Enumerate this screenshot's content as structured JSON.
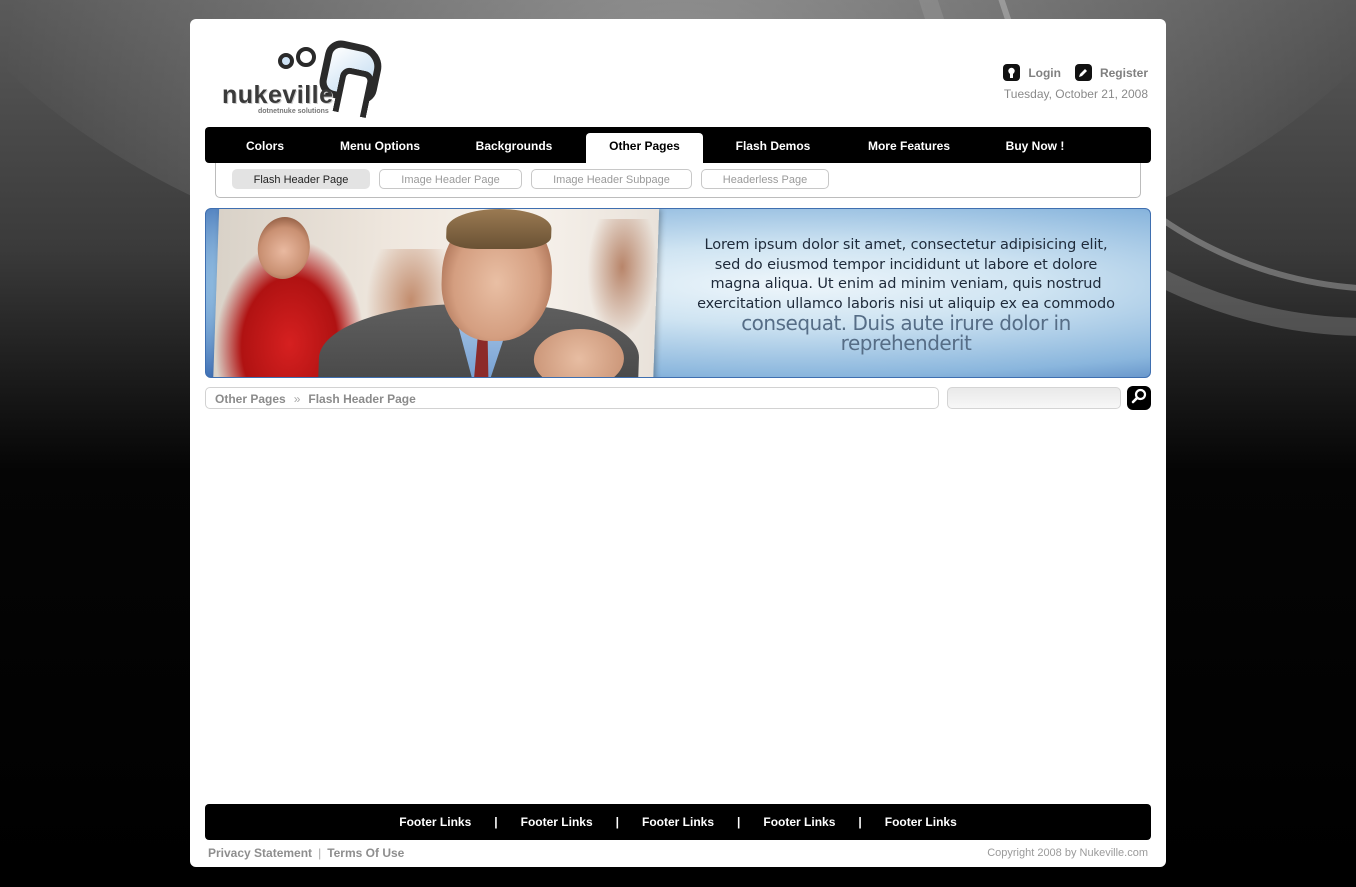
{
  "logo": {
    "name": "nukeville",
    "tagline": "dotnetnuke solutions"
  },
  "userbar": {
    "login_label": "Login",
    "register_label": "Register",
    "date": "Tuesday, October 21, 2008"
  },
  "main_nav": {
    "tabs": [
      {
        "label": "Colors"
      },
      {
        "label": "Menu Options"
      },
      {
        "label": "Backgrounds"
      },
      {
        "label": "Other Pages",
        "active": true
      },
      {
        "label": "Flash Demos"
      },
      {
        "label": "More Features"
      },
      {
        "label": "Buy Now !"
      }
    ]
  },
  "sub_nav": {
    "items": [
      {
        "label": "Flash Header Page",
        "active": true
      },
      {
        "label": "Image Header Page"
      },
      {
        "label": "Image Header Subpage"
      },
      {
        "label": "Headerless Page"
      }
    ]
  },
  "banner": {
    "line1": "Lorem ipsum dolor sit amet, consectetur adipisicing elit,",
    "line2": "sed do eiusmod tempor incididunt ut labore et dolore",
    "line3": "magna aliqua. Ut enim ad minim veniam, quis nostrud",
    "line4": "exercitation ullamco laboris nisi ut aliquip ex ea commodo",
    "line5": "consequat. Duis aute irure dolor in reprehenderit"
  },
  "breadcrumb": {
    "parent": "Other Pages",
    "separator": "»",
    "current": "Flash Header Page"
  },
  "search": {
    "placeholder": "",
    "button_icon": "search-icon"
  },
  "footer": {
    "links": [
      "Footer Links",
      "Footer Links",
      "Footer Links",
      "Footer Links",
      "Footer Links"
    ],
    "separator": "|",
    "privacy_label": "Privacy Statement",
    "divider": "|",
    "terms_label": "Terms Of Use",
    "copyright": "Copyright 2008 by Nukeville.com"
  },
  "colors": {
    "nav_bg": "#000000",
    "page_bg": "#ffffff",
    "banner_accent": "#3f70b5"
  }
}
